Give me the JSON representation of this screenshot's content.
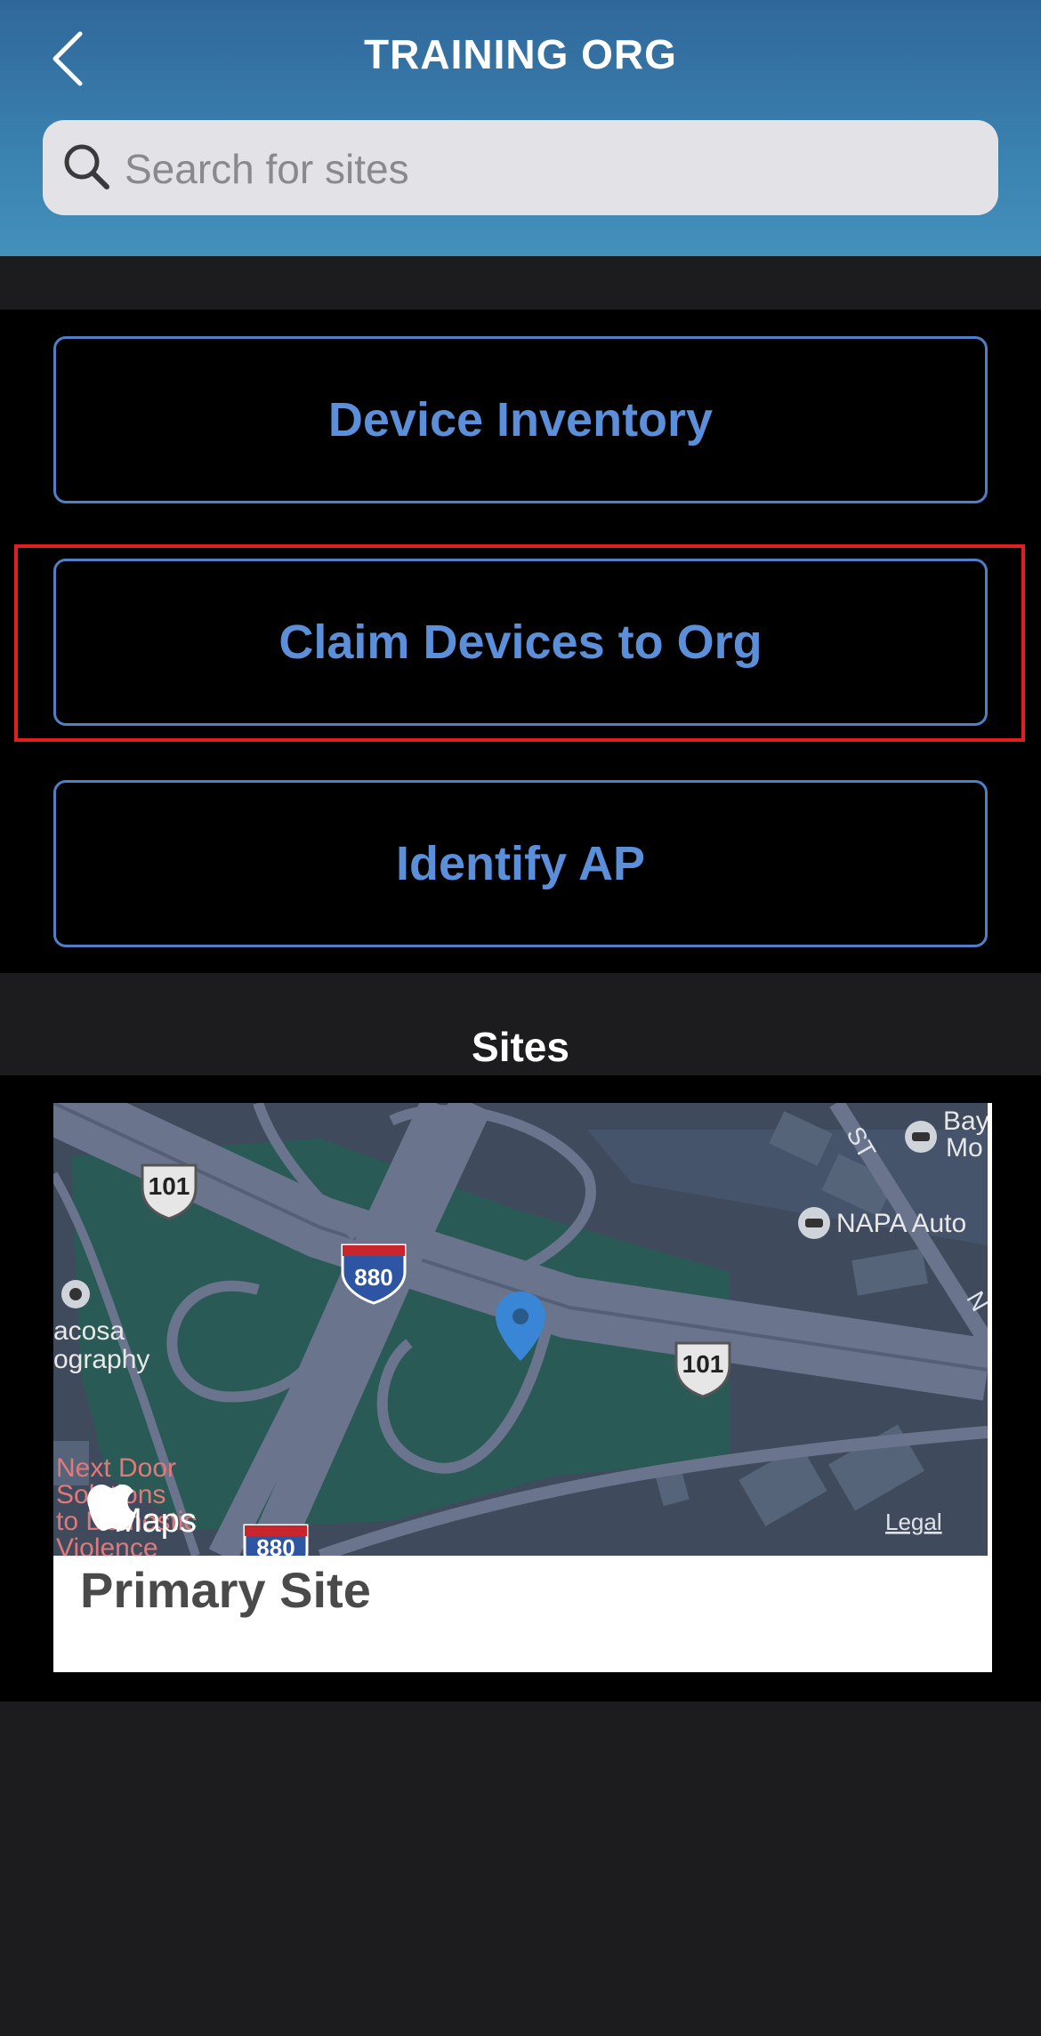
{
  "header": {
    "title": "TRAINING ORG",
    "back_icon": "chevron-left-icon"
  },
  "search": {
    "placeholder": "Search for sites",
    "value": "",
    "icon": "search-icon"
  },
  "actions": {
    "device_inventory": "Device Inventory",
    "claim_devices": "Claim Devices to Org",
    "identify_ap": "Identify AP"
  },
  "sites": {
    "heading": "Sites",
    "items": [
      {
        "name": "Primary Site",
        "map": {
          "shields": [
            "101",
            "880",
            "101",
            "880"
          ],
          "poi": [
            "Bay Mo",
            "NAPA Auto",
            "acosa",
            "ography",
            "Next Door",
            "Solutions",
            "to Domestic",
            "Violence"
          ],
          "street_labels": [
            "ST",
            "N"
          ],
          "provider": "Maps",
          "legal": "Legal"
        }
      }
    ]
  },
  "colors": {
    "header_top": "#30679a",
    "header_bottom": "#4390bb",
    "button_text": "#5b8fd9",
    "button_border": "#4f7fc7",
    "highlight": "#e02020",
    "pin": "#3a86d6"
  }
}
